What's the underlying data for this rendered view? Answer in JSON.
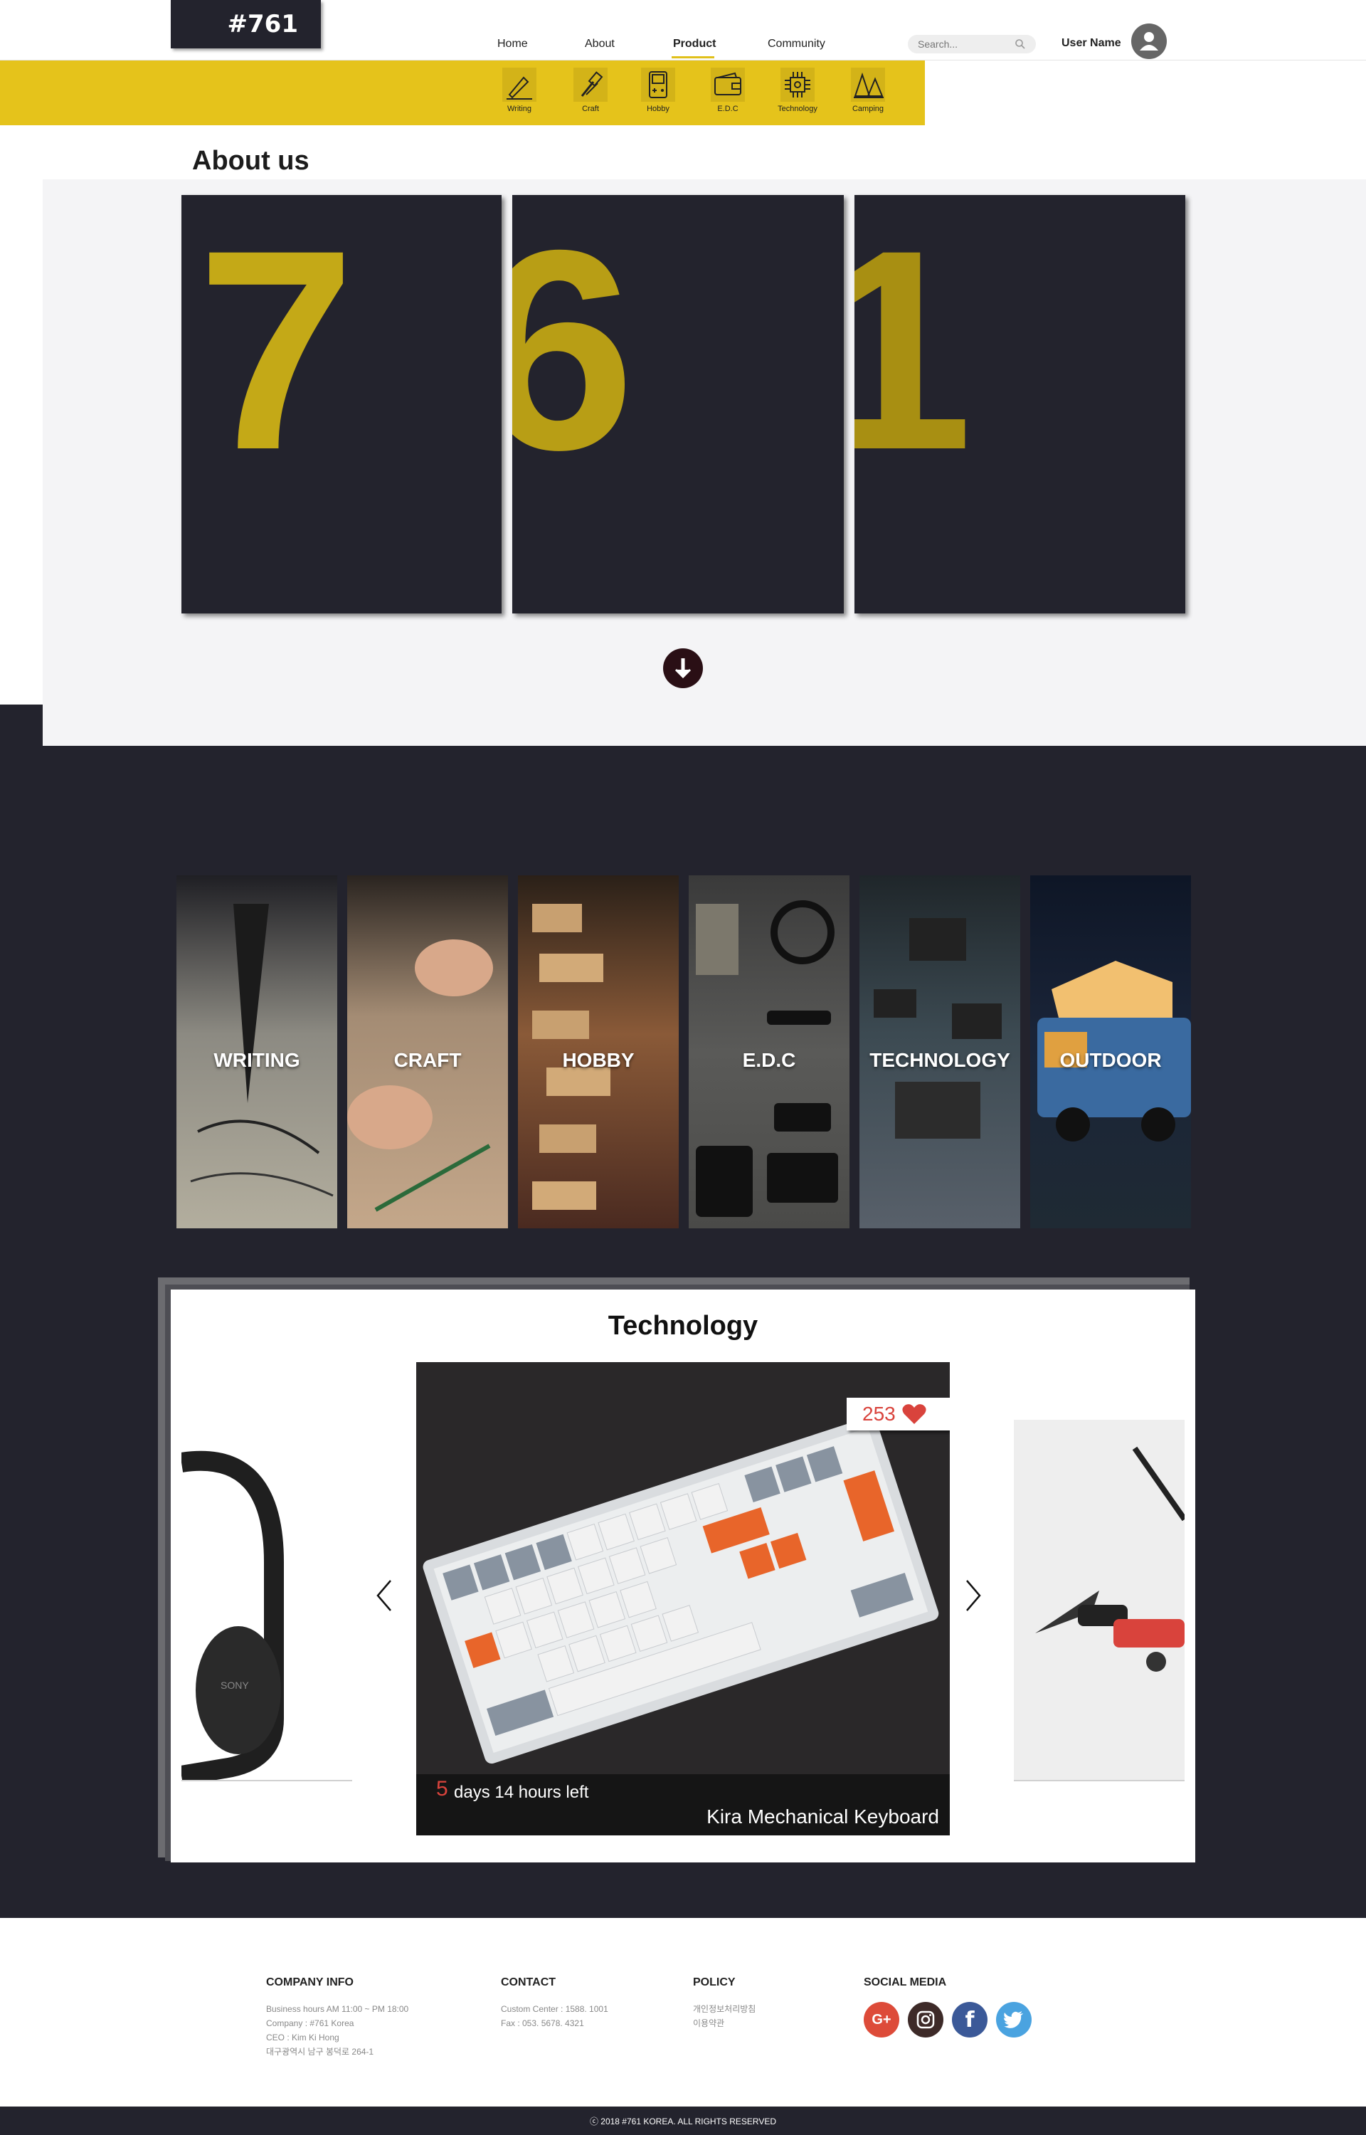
{
  "header": {
    "logo": "#761",
    "nav": [
      "Home",
      "About",
      "Product",
      "Community"
    ],
    "active_nav": "Product",
    "search_placeholder": "Search...",
    "user_name": "User Name"
  },
  "categories": [
    {
      "label": "Writing",
      "icon": "pen-nib-icon"
    },
    {
      "label": "Craft",
      "icon": "brushes-icon"
    },
    {
      "label": "Hobby",
      "icon": "game-console-icon"
    },
    {
      "label": "E.D.C",
      "icon": "wallet-icon"
    },
    {
      "label": "Technology",
      "icon": "chip-icon"
    },
    {
      "label": "Camping",
      "icon": "tent-icon"
    }
  ],
  "about": {
    "title": "About us",
    "digits": [
      "7",
      "6",
      "1"
    ]
  },
  "strips": [
    "WRITING",
    "CRAFT",
    "HOBBY",
    "E.D.C",
    "TECHNOLOGY",
    "OUTDOOR"
  ],
  "technology": {
    "title": "Technology",
    "likes": "253",
    "days_left": "5",
    "time_left_suffix": "days 14 hours left",
    "product_name": "Kira Mechanical Keyboard",
    "side_left_brand": "SONY"
  },
  "footer": {
    "company_info": {
      "heading": "COMPANY INFO",
      "lines": [
        "Business hours AM 11:00 ~ PM 18:00",
        "Company : #761 Korea",
        "CEO : Kim Ki Hong",
        "대구광역시 남구 봉덕로 264-1"
      ]
    },
    "contact": {
      "heading": "CONTACT",
      "lines": [
        "Custom Center : 1588. 1001",
        "Fax : 053. 5678. 4321"
      ]
    },
    "policy": {
      "heading": "POLICY",
      "lines": [
        "개인정보처리방침",
        "이용약관"
      ]
    },
    "social": {
      "heading": "SOCIAL MEDIA",
      "icons": [
        "google-plus-icon",
        "instagram-icon",
        "facebook-icon",
        "twitter-icon"
      ]
    },
    "copyright": "ⓒ 2018 #761 KOREA. ALL RIGHTS RESERVED"
  },
  "colors": {
    "accent": "#e5c31b",
    "dark": "#23232d",
    "digit": "#c4a917",
    "highlight_red": "#d9433c"
  }
}
